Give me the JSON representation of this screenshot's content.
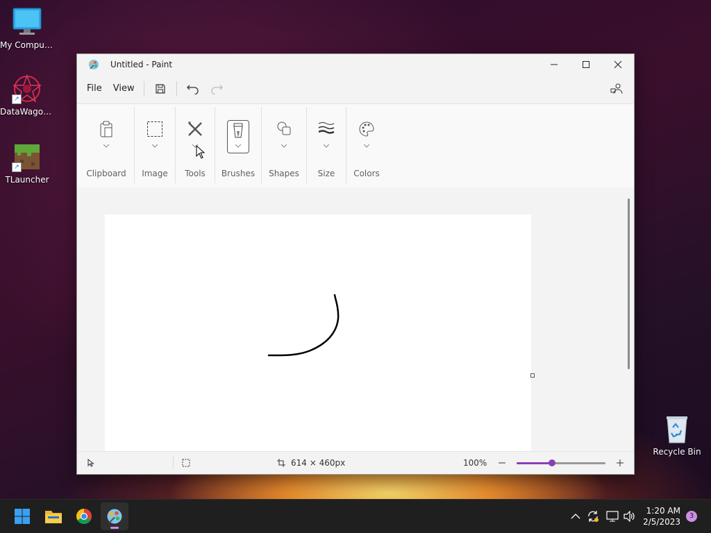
{
  "desktop": {
    "icons": [
      {
        "label": "My Computer"
      },
      {
        "label": "DataWagon..."
      },
      {
        "label": "TLauncher"
      },
      {
        "label": "Recycle Bin"
      }
    ]
  },
  "window": {
    "title": "Untitled - Paint",
    "menu": {
      "file": "File",
      "view": "View"
    },
    "ribbon": {
      "groups": [
        "Clipboard",
        "Image",
        "Tools",
        "Brushes",
        "Shapes",
        "Size",
        "Colors"
      ]
    },
    "status": {
      "canvas_size": "614 × 460px",
      "zoom": "100%",
      "zoom_fraction": 0.4
    }
  },
  "taskbar": {
    "time": "1:20 AM",
    "date": "2/5/2023",
    "notifications": "3"
  }
}
